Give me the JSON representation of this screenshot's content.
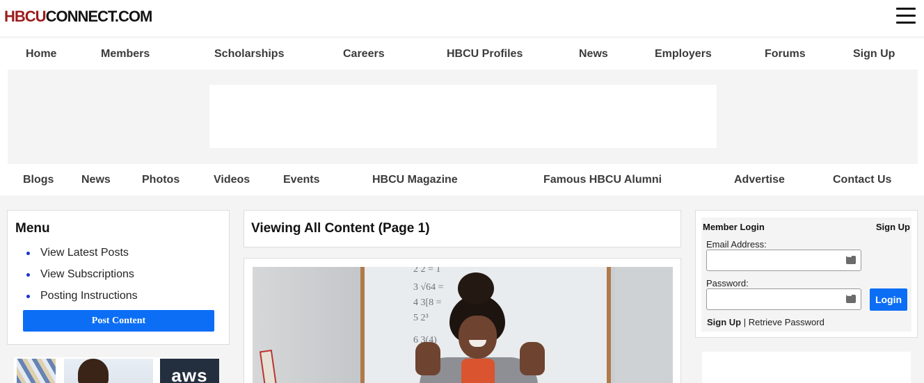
{
  "logo": {
    "text_a": "HBCU",
    "text_b": "CONNECT.COM"
  },
  "nav_primary": [
    {
      "label": "Home"
    },
    {
      "label": "Members"
    },
    {
      "label": "Scholarships"
    },
    {
      "label": "Careers"
    },
    {
      "label": "HBCU Profiles"
    },
    {
      "label": "News"
    },
    {
      "label": "Employers"
    },
    {
      "label": "Forums"
    },
    {
      "label": "Sign Up"
    }
  ],
  "nav_secondary": [
    {
      "label": "Blogs"
    },
    {
      "label": "News"
    },
    {
      "label": "Photos"
    },
    {
      "label": "Videos"
    },
    {
      "label": "Events"
    },
    {
      "label": "HBCU Magazine"
    },
    {
      "label": "Famous HBCU Alumni"
    },
    {
      "label": "Advertise"
    },
    {
      "label": "Contact Us"
    }
  ],
  "menu": {
    "title": "Menu",
    "items": [
      {
        "label": "View Latest Posts"
      },
      {
        "label": "View Subscriptions"
      },
      {
        "label": "Posting Instructions"
      }
    ],
    "post_button": "Post Content"
  },
  "promo": {
    "aws_text": "aws"
  },
  "main": {
    "title": "Viewing All Content (Page 1)"
  },
  "whiteboard": [
    "2  2  =  1",
    "3  √64  =",
    "4  3[8  =",
    "5  2³",
    "6  3(4)"
  ],
  "login": {
    "heading": "Member Login",
    "signup_link": "Sign Up",
    "email_label": "Email Address:",
    "password_label": "Password:",
    "login_button": "Login",
    "bottom_signup": "Sign Up",
    "separator": " | ",
    "retrieve": "Retrieve Password"
  },
  "colors": {
    "accent": "#0b6ef5",
    "bullet": "#1a34c9",
    "brand_red": "#9c1c1c"
  }
}
